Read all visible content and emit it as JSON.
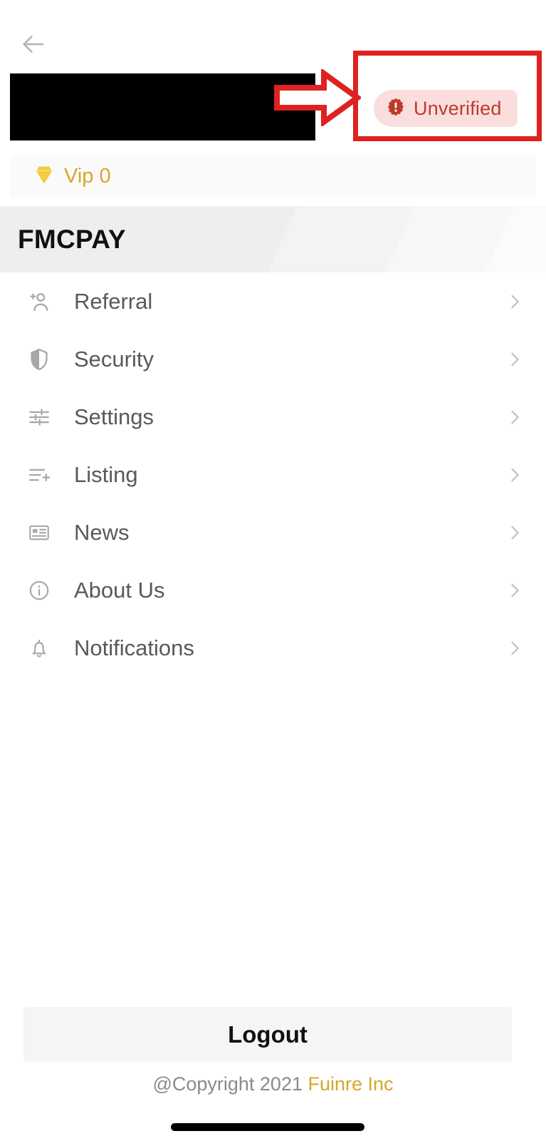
{
  "topbar": {
    "back_icon": "arrow-left-icon"
  },
  "identity": {
    "name_redacted": "",
    "verification": {
      "label": "Unverified",
      "icon": "seal-warning-icon",
      "text_color": "#c0392b",
      "background_color": "#f9dedd"
    }
  },
  "vip": {
    "icon": "diamond-icon",
    "label": "Vip 0",
    "color": "#d8a62a"
  },
  "brand": {
    "name": "FMCPAY"
  },
  "menu": {
    "items": [
      {
        "label": "Referral",
        "icon": "person-add-icon",
        "chevron": "chevron-right-icon"
      },
      {
        "label": "Security",
        "icon": "shield-icon",
        "chevron": "chevron-right-icon"
      },
      {
        "label": "Settings",
        "icon": "sliders-icon",
        "chevron": "chevron-right-icon"
      },
      {
        "label": "Listing",
        "icon": "playlist-add-icon",
        "chevron": "chevron-right-icon"
      },
      {
        "label": "News",
        "icon": "article-icon",
        "chevron": "chevron-right-icon"
      },
      {
        "label": "About Us",
        "icon": "info-circle-icon",
        "chevron": "chevron-right-icon"
      },
      {
        "label": "Notifications",
        "icon": "bell-icon",
        "chevron": "chevron-right-icon"
      }
    ]
  },
  "footer": {
    "logout_label": "Logout",
    "copyright_prefix": "@Copyright 2021 ",
    "copyright_brand": "Fuinre Inc"
  },
  "annotation": {
    "highlight_color": "#e02121",
    "shapes": [
      "rectangle-highlight",
      "arrow-pointer"
    ]
  }
}
